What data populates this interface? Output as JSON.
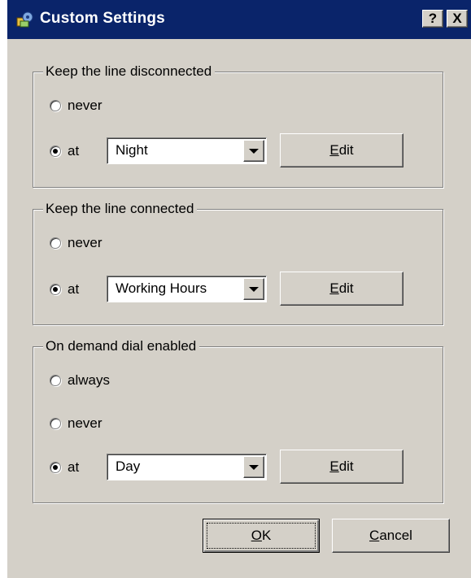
{
  "window": {
    "title": "Custom Settings",
    "help_label": "?",
    "close_label": "X"
  },
  "group_disconnected": {
    "legend": "Keep the line disconnected",
    "never_label": "never",
    "at_label": "at",
    "schedule_value": "Night",
    "edit_label": "Edit",
    "edit_mnemonic": "E",
    "edit_rest": "dit",
    "selected": "at"
  },
  "group_connected": {
    "legend": "Keep the line connected",
    "never_label": "never",
    "at_label": "at",
    "schedule_value": "Working Hours",
    "edit_label": "Edit",
    "edit_mnemonic": "E",
    "edit_rest": "dit",
    "selected": "at"
  },
  "group_demand": {
    "legend": "On demand dial enabled",
    "always_label": "always",
    "never_label": "never",
    "at_label": "at",
    "schedule_value": "Day",
    "edit_label": "Edit",
    "edit_mnemonic": "E",
    "edit_rest": "dit",
    "selected": "at"
  },
  "footer": {
    "ok_label": "OK",
    "ok_mnemonic": "O",
    "ok_rest": "K",
    "cancel_label": "Cancel",
    "cancel_mnemonic": "C",
    "cancel_rest": "ancel"
  }
}
